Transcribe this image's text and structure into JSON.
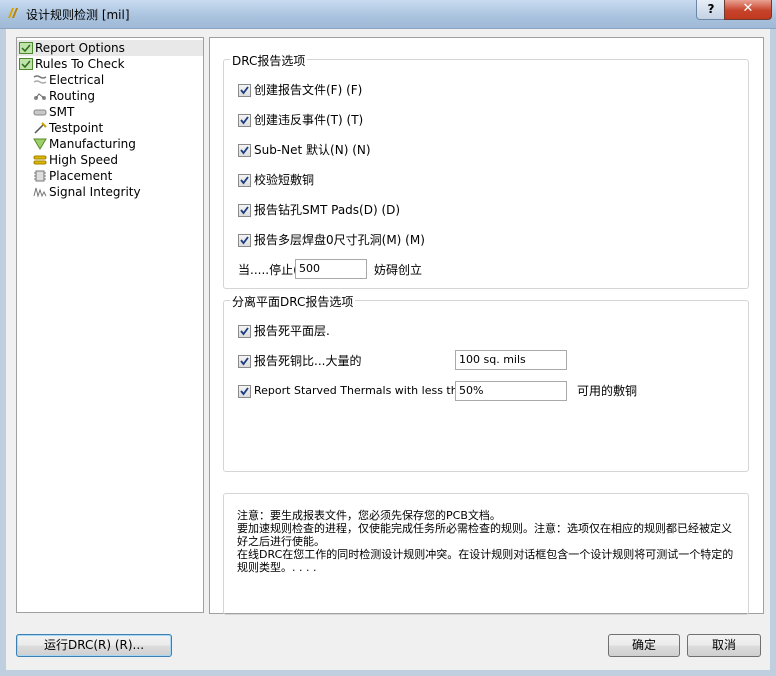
{
  "window": {
    "title": "设计规则检测 [mil]",
    "help_label": "?",
    "close_label": "✕"
  },
  "tree": {
    "items": [
      {
        "label": "Report Options",
        "icon": "report-options-icon"
      },
      {
        "label": "Rules To Check",
        "icon": "rules-to-check-icon"
      },
      {
        "label": "Electrical",
        "icon": "electrical-icon"
      },
      {
        "label": "Routing",
        "icon": "routing-icon"
      },
      {
        "label": "SMT",
        "icon": "smt-icon"
      },
      {
        "label": "Testpoint",
        "icon": "testpoint-icon"
      },
      {
        "label": "Manufacturing",
        "icon": "manufacturing-icon"
      },
      {
        "label": "High Speed",
        "icon": "high-speed-icon"
      },
      {
        "label": "Placement",
        "icon": "placement-icon"
      },
      {
        "label": "Signal Integrity",
        "icon": "signal-integrity-icon"
      }
    ]
  },
  "drc_options": {
    "legend": "DRC报告选项",
    "checkboxes": [
      {
        "label": "创建报告文件(F) (F)",
        "checked": true
      },
      {
        "label": "创建违反事件(T) (T)",
        "checked": true
      },
      {
        "label": "Sub-Net 默认(N) (N)",
        "checked": true
      },
      {
        "label": "校验短敷铜",
        "checked": true
      },
      {
        "label": "报告钻孔SMT Pads(D) (D)",
        "checked": true
      },
      {
        "label": "报告多层焊盘0尺寸孔洞(M) (M)",
        "checked": true
      }
    ],
    "stop_prefix": "当.....停止(I",
    "stop_value": "500",
    "stop_suffix": "妨碍创立"
  },
  "split_plane_options": {
    "legend": "分离平面DRC报告选项",
    "dead_plane_label": "报告死平面层.",
    "dead_copper_label": "报告死铜比...大量的",
    "dead_copper_value": "100 sq. mils",
    "starved_label": "Report Starved Thermals with less than",
    "starved_value": "50%",
    "starved_suffix": "可用的敷铜"
  },
  "note": {
    "lines": [
      "注意：要生成报表文件，您必须先保存您的PCB文档。",
      "要加速规则检查的进程，仅使能完成任务所必需检查的规则。注意：选项仅在相应的规则都已经被定义好之后进行使能。",
      "在线DRC在您工作的同时检测设计规则冲突。在设计规则对话框包含一个设计规则将可测试一个特定的规则类型。. . . ."
    ]
  },
  "buttons": {
    "run_drc": "运行DRC(R) (R)...",
    "ok": "确定",
    "cancel": "取消"
  },
  "colors": {
    "titlebar": "#a9c2de",
    "close_button": "#c7432b",
    "focus_border": "#3c7fb1"
  }
}
